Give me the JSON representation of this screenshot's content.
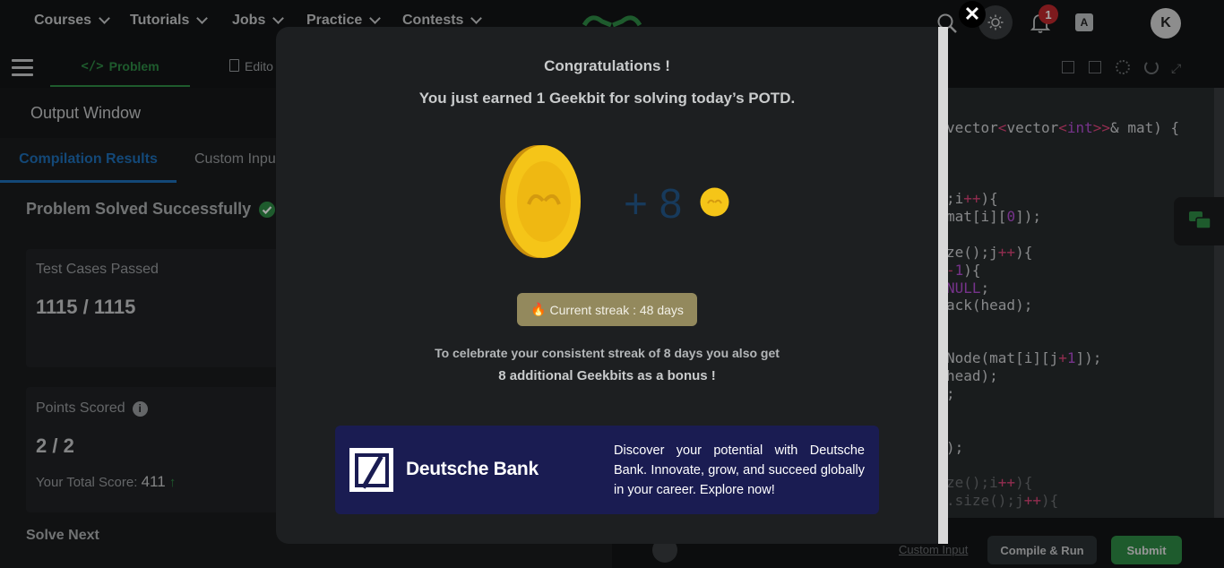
{
  "nav": {
    "items": [
      {
        "label": "Courses"
      },
      {
        "label": "Tutorials"
      },
      {
        "label": "Jobs"
      },
      {
        "label": "Practice"
      },
      {
        "label": "Contests"
      }
    ],
    "notification_count": "1",
    "avatar_initial": "K",
    "translate_label": "A"
  },
  "problem_tabs": {
    "problem": "Problem",
    "editorial": "Edito"
  },
  "output": {
    "title": "Output Window",
    "tabs": [
      "Compilation Results",
      "Custom Inpu"
    ],
    "status": "Problem Solved Successfully",
    "test_cases_label": "Test Cases Passed",
    "test_cases_value": "1115 / 1115",
    "points_label": "Points Scored",
    "points_value": "2 / 2",
    "total_score_label": "Your Total Score:",
    "total_score_value": "411",
    "solve_next": "Solve Next"
  },
  "editor": {
    "lines": [
      "vector<vector<int>>& mat) {",
      ";i++){",
      "mat[i][0]);",
      "ze();j++){",
      "-1){",
      "NULL;",
      "ack(head);",
      "Node(mat[i][j+1]);",
      "head);",
      ";",
      ");",
      "ze();i++){",
      ".size();j++){"
    ],
    "custom_input_link": "Custom Input",
    "compile_button": "Compile & Run",
    "submit_button": "Submit"
  },
  "modal": {
    "title": "Congratulations !",
    "earned": "You just earned 1 Geekbit for solving today’s POTD.",
    "bonus_amount": "+ 8",
    "streak": "Current streak : 48 days",
    "bonus_line1": "To celebrate your consistent streak of 8 days you also get",
    "bonus_line2": "8 additional Geekbits as a bonus !",
    "close": "✕"
  },
  "ad": {
    "brand": "Deutsche Bank",
    "text": "Discover your potential with Deutsche Bank. Innovate, grow, and succeed globally in your career. Explore now!"
  },
  "colors": {
    "brand_green": "#2f8d46",
    "link_blue": "#1e6fb8",
    "coin_gold": "#f5c518",
    "ad_bg": "#1a1c52"
  }
}
